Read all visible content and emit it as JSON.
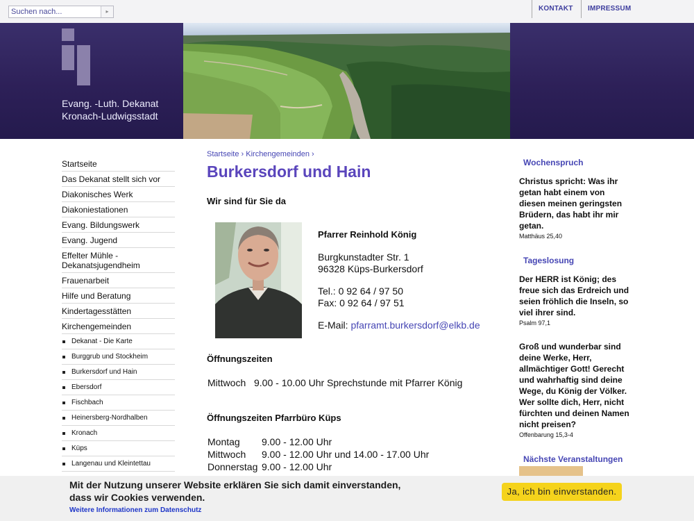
{
  "topbar": {
    "search_placeholder": "Suchen nach...",
    "search_button": "▸",
    "links": [
      "KONTAKT",
      "IMPRESSUM"
    ]
  },
  "header": {
    "brand_line1": "Evang. -Luth. Dekanat",
    "brand_line2": "Kronach-Ludwigsstadt"
  },
  "sidebar": {
    "items": [
      "Startseite",
      "Das Dekanat stellt sich vor",
      "Diakonisches Werk",
      "Diakoniestationen",
      "Evang. Bildungswerk",
      "Evang. Jugend",
      "Effelter Mühle - Dekanatsjugendheim",
      "Frauenarbeit",
      "Hilfe und Beratung",
      "Kindertagesstätten",
      "Kirchengemeinden"
    ],
    "subitems": [
      "Dekanat - Die Karte",
      "Burggrub und Stockheim",
      "Burkersdorf und Hain",
      "Ebersdorf",
      "Fischbach",
      "Heinersberg-Nordhalben",
      "Kronach",
      "Küps",
      "Langenau und Kleintettau"
    ]
  },
  "main": {
    "breadcrumb": [
      "Startseite",
      "Kirchengemeinden"
    ],
    "title": "Burkersdorf und Hain",
    "heading1": "Wir sind für Sie da",
    "pastor": "Pfarrer Reinhold König",
    "address1": "Burgkunstadter Str. 1",
    "address2": "96328 Küps-Burkersdorf",
    "tel": "Tel.: 0 92 64 / 97 50",
    "fax": "Fax: 0 92 64 / 97 51",
    "email_label": "E-Mail: ",
    "email": "pfarramt.burkersdorf@elkb.de",
    "heading2": "Öffnungszeiten",
    "hours1": [
      {
        "day": "Mittwoch",
        "time": "9.00 - 10.00 Uhr Sprechstunde mit Pfarrer König"
      }
    ],
    "heading3": "Öffnungszeiten Pfarrbüro Küps",
    "hours2": [
      {
        "day": "Montag",
        "time": "9.00 - 12.00 Uhr"
      },
      {
        "day": "Mittwoch",
        "time": "9.00 - 12.00 Uhr und 14.00 - 17.00 Uhr"
      },
      {
        "day": "Donnerstag",
        "time": "9.00 - 12.00 Uhr"
      }
    ]
  },
  "right": {
    "wochenspruch_title": "Wochenspruch",
    "wochenspruch_text": "Christus spricht: Was ihr getan habt einem von diesen meinen geringsten Brüdern, das habt ihr mir getan.",
    "wochenspruch_ref": "Matthäus 25,40",
    "tageslosung_title": "Tageslosung",
    "tageslosung_text": "Der HERR ist König; des freue sich das Erdreich und seien fröhlich die Inseln, so viel ihrer sind.",
    "tageslosung_ref": "Psalm 97,1",
    "lehrtext_text": "Groß und wunderbar sind deine Werke, Herr, allmächtiger Gott! Gerecht und wahrhaftig sind deine Wege, du König der Völker. Wer sollte dich, Herr, nicht fürchten und deinen Namen nicht preisen?",
    "lehrtext_ref": "Offenbarung 15,3-4",
    "events_title": "Nächste Veranstaltungen"
  },
  "cookie": {
    "line1": "Mit der Nutzung unserer Website erklären Sie sich damit einverstanden,",
    "line2": "dass wir Cookies verwenden.",
    "link": "Weitere Informationen zum Datenschutz",
    "button": "Ja, ich bin einverstanden."
  },
  "colors": {
    "accent": "#5a45bc",
    "link": "#4646b4",
    "header": "#2d2058",
    "cookie_button": "#f5d31c"
  }
}
